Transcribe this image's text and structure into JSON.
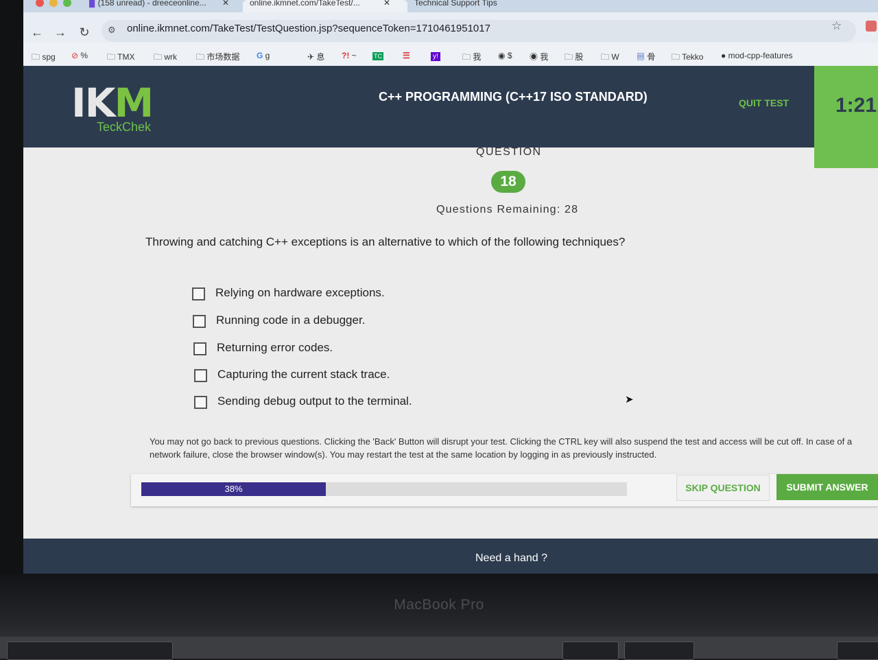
{
  "browser": {
    "tabs": [
      {
        "label": "(158 unread) - dreeceonline..."
      },
      {
        "label": "online.ikmnet.com/TakeTest/..."
      },
      {
        "label": "Technical Support Tips"
      }
    ],
    "url": "online.ikmnet.com/TakeTest/TestQuestion.jsp?sequenceToken=1710461951017",
    "bookmarks": [
      {
        "label": "spg",
        "icon": "folder-icon"
      },
      {
        "label": "%",
        "icon": "no-entry-icon"
      },
      {
        "label": "TMX",
        "icon": "folder-icon"
      },
      {
        "label": "wrk",
        "icon": "folder-icon"
      },
      {
        "label": "市场数据",
        "icon": "folder-icon"
      },
      {
        "label": "g",
        "icon": "google-icon"
      },
      {
        "label": "息",
        "icon": "site-icon"
      },
      {
        "label": "~",
        "icon": "site-icon"
      },
      {
        "label": "我",
        "icon": "folder-icon"
      },
      {
        "label": "$",
        "icon": "globe-icon"
      },
      {
        "label": "我",
        "icon": "globe-icon"
      },
      {
        "label": "股",
        "icon": "folder-icon"
      },
      {
        "label": "W",
        "icon": "folder-icon"
      },
      {
        "label": "骨",
        "icon": "grid-icon"
      },
      {
        "label": "Tekko",
        "icon": "folder-icon"
      },
      {
        "label": "mod-cpp-features",
        "icon": "github-icon"
      }
    ]
  },
  "header": {
    "logo_text": "IKM",
    "logo_sub": "TeckChek",
    "test_title": "C++ PROGRAMMING (C++17 ISO STANDARD)",
    "quit_label": "QUIT TEST",
    "timer": "1:21"
  },
  "question": {
    "label": "QUESTION",
    "number": "18",
    "remaining": "Questions Remaining: 28",
    "text": "Throwing and catching C++ exceptions is an alternative to which of the following techniques?",
    "options": [
      "Relying on hardware exceptions.",
      "Running code in a debugger.",
      "Returning error codes.",
      "Capturing the current stack trace.",
      "Sending debug output to the terminal."
    ]
  },
  "notice": "You may not go back to previous questions. Clicking the 'Back' Button will disrupt your test. Clicking the CTRL key will also suspend the test and access will be cut off. In case of a network failure, close the browser window(s). You may restart the test at the same location by logging in as previously instructed.",
  "progress": {
    "label": "38%",
    "fraction": 0.38
  },
  "actions": {
    "skip_label": "SKIP QUESTION",
    "submit_label": "SUBMIT ANSWER"
  },
  "footer": {
    "help_label": "Need a hand ?"
  },
  "device": {
    "label": "MacBook Pro"
  },
  "colors": {
    "header": "#2d3b4f",
    "accent_green": "#5bab43",
    "progress": "#3a2f8a"
  }
}
